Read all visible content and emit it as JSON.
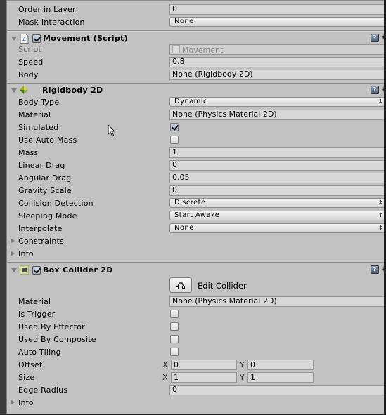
{
  "renderer_partial": {
    "order_in_layer": {
      "label": "Order in Layer",
      "value": "0"
    },
    "mask_interaction": {
      "label": "Mask Interaction",
      "value": "None"
    }
  },
  "movement": {
    "title": "Movement (Script)",
    "enabled": true,
    "icon": "csharp-script-icon",
    "fields": {
      "script": {
        "label": "Script",
        "value": "Movement"
      },
      "speed": {
        "label": "Speed",
        "value": "0.8"
      },
      "body": {
        "label": "Body",
        "value": "None (Rigidbody 2D)"
      }
    }
  },
  "rigidbody": {
    "title": "Rigidbody 2D",
    "icon": "rigidbody2d-icon",
    "fields": {
      "body_type": {
        "label": "Body Type",
        "value": "Dynamic"
      },
      "material": {
        "label": "Material",
        "value": "None (Physics Material 2D)"
      },
      "simulated": {
        "label": "Simulated",
        "checked": true
      },
      "use_auto_mass": {
        "label": "Use Auto Mass",
        "checked": false
      },
      "mass": {
        "label": "Mass",
        "value": "1"
      },
      "linear_drag": {
        "label": "Linear Drag",
        "value": "0"
      },
      "angular_drag": {
        "label": "Angular Drag",
        "value": "0.05"
      },
      "gravity_scale": {
        "label": "Gravity Scale",
        "value": "0"
      },
      "collision_detection": {
        "label": "Collision Detection",
        "value": "Discrete"
      },
      "sleeping_mode": {
        "label": "Sleeping Mode",
        "value": "Start Awake"
      },
      "interpolate": {
        "label": "Interpolate",
        "value": "None"
      }
    },
    "foldouts": {
      "constraints": "Constraints",
      "info": "Info"
    }
  },
  "box_collider": {
    "title": "Box Collider 2D",
    "enabled": true,
    "icon": "box-collider-icon",
    "edit_collider_label": "Edit Collider",
    "fields": {
      "material": {
        "label": "Material",
        "value": "None (Physics Material 2D)"
      },
      "is_trigger": {
        "label": "Is Trigger",
        "checked": false
      },
      "used_by_effector": {
        "label": "Used By Effector",
        "checked": false
      },
      "used_by_composite": {
        "label": "Used By Composite",
        "checked": false
      },
      "auto_tiling": {
        "label": "Auto Tiling",
        "checked": false
      },
      "offset": {
        "label": "Offset",
        "x_label": "X",
        "x": "0",
        "y_label": "Y",
        "y": "0"
      },
      "size": {
        "label": "Size",
        "x_label": "X",
        "x": "1",
        "y_label": "Y",
        "y": "1"
      },
      "edge_radius": {
        "label": "Edge Radius",
        "value": "0"
      }
    },
    "foldouts": {
      "info": "Info"
    }
  },
  "dropdown_arrows": "↕",
  "help_glyph": "?",
  "gear_glyph": "⚙"
}
